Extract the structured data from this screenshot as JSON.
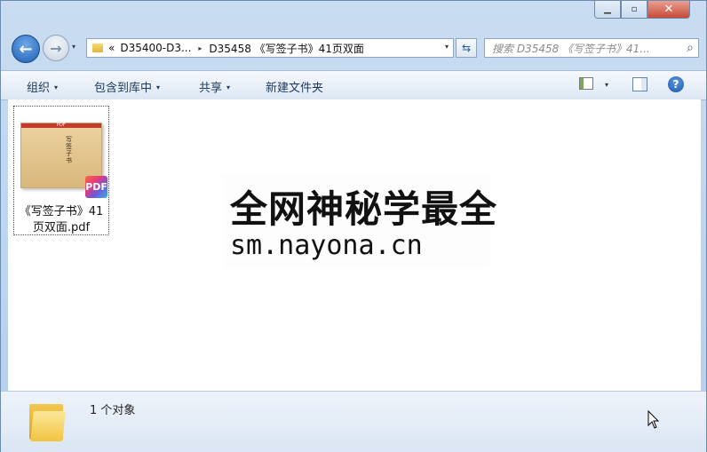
{
  "window": {
    "controls": {
      "min": "▁",
      "max": "▫",
      "close": "✕"
    }
  },
  "nav": {
    "back_glyph": "←",
    "forward_glyph": "→",
    "history_glyph": "▾"
  },
  "address": {
    "overflow": "«",
    "crumbs": [
      "D35400-D3...",
      "D35458 《写签子书》41页双面"
    ],
    "separator": "▸",
    "drop": "▾"
  },
  "refresh_glyph": "⇆",
  "search": {
    "placeholder": "搜索 D35458 《写签子书》41...",
    "icon": "search-icon"
  },
  "toolbar": {
    "organize": "组织",
    "include_in_library": "包含到库中",
    "share": "共享",
    "new_folder": "新建文件夹",
    "arrow": "▾",
    "help": "?"
  },
  "file": {
    "name_line1": "《写签子书》41",
    "name_line2": "页双面.pdf",
    "thumb_band": "PDF",
    "thumb_vertical": "写签子书",
    "badge": "PDF"
  },
  "watermark": {
    "line1": "全网神秘学最全",
    "line2": "sm.nayona.cn"
  },
  "details": {
    "count": "1 个对象"
  },
  "colors": {
    "accent": "#1d5fb3",
    "chrome": "#c9dcf1",
    "close": "#c74a38"
  }
}
